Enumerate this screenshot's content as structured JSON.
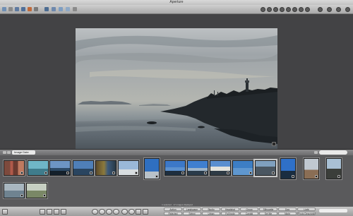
{
  "window": {
    "title": "Aperture"
  },
  "colors": {
    "selection": "#c8c8c8",
    "viewer_bg": "#434345",
    "browser_bg": "#5a5a5c"
  },
  "filmstrip": {
    "sort_label": "Image Date",
    "thumbnails": [
      {
        "name": "red-doors",
        "selected": false
      },
      {
        "name": "rooftop",
        "selected": false
      },
      {
        "name": "shoreline-1",
        "selected": false
      },
      {
        "name": "shoreline-2",
        "selected": false
      },
      {
        "name": "trees-lake",
        "selected": false
      },
      {
        "name": "winter-trees",
        "selected": false
      },
      {
        "name": "tree-sky",
        "selected": false
      },
      {
        "name": "coast-1",
        "selected": false
      },
      {
        "name": "coast-2",
        "selected": false
      },
      {
        "name": "bright-coast",
        "selected": false
      },
      {
        "name": "blue-water",
        "selected": false
      },
      {
        "name": "rocks",
        "selected": true
      },
      {
        "name": "blue-sky",
        "selected": false
      },
      {
        "name": "bare-tree",
        "selected": false
      },
      {
        "name": "silhouette",
        "selected": false
      },
      {
        "name": "hazy-sea",
        "selected": false
      },
      {
        "name": "landscape",
        "selected": false
      }
    ]
  },
  "status": {
    "text": "1 selected · 17 images displayed"
  },
  "keywords": {
    "row1": [
      "Action",
      "Landscape",
      "Studio",
      "Headshot",
      "Group",
      "Silhouette",
      "Dog",
      "Light"
    ],
    "row2": [
      "Rejected",
      "Select",
      "Urban",
      "Full body",
      "Candid",
      "Set Me",
      "Night",
      "Photo Description"
    ]
  }
}
